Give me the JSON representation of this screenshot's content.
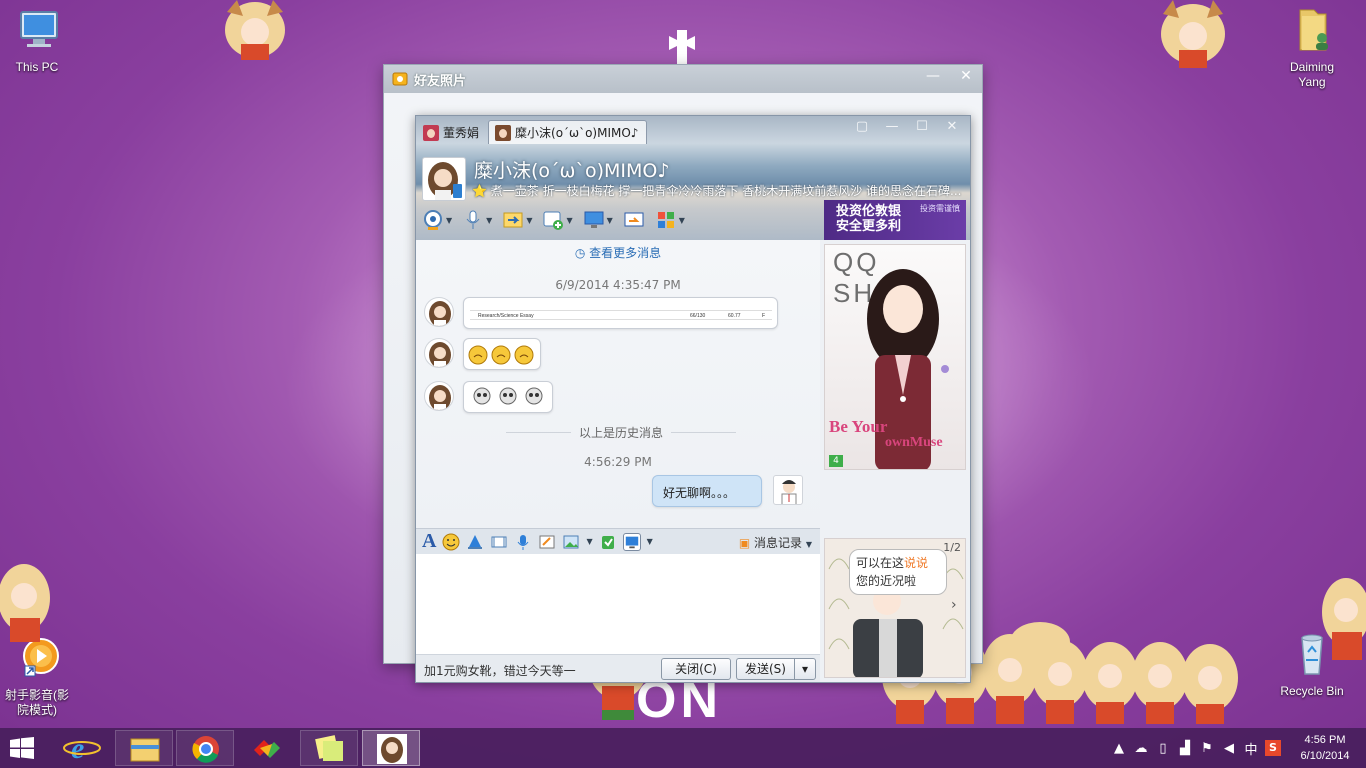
{
  "desktop": {
    "icons": {
      "this_pc": "This PC",
      "user_folder_line1": "Daiming",
      "user_folder_line2": "Yang",
      "player_line1": "射手影音(影",
      "player_line2": "院模式)",
      "recycle_bin": "Recycle Bin"
    },
    "wallpaper_text": "ON"
  },
  "photo_window": {
    "title": "好友照片",
    "minimize": "—",
    "close": "✕"
  },
  "chat_window": {
    "tabs": [
      {
        "label": "董秀娟"
      },
      {
        "label": "糜小沫(o´ω`o)MIMO♪"
      }
    ],
    "controls": {
      "restore": "▢",
      "minimize": "—",
      "maximize": "☐",
      "close": "✕"
    },
    "contact": {
      "name": "糜小沫(o´ω`o)MIMO♪",
      "signature": "⭐ 煮一壶茶 折一枝白梅花 撑一把青伞冷冷雨落下 香桃木开满坟前惹风沙 谁的思念在石碑..."
    },
    "ad_top": {
      "line1": "投资伦敦银",
      "line2": "安全更多利",
      "tag": "投资需谨慎"
    },
    "more_messages": "查看更多消息",
    "messages": {
      "timestamp1": "6/9/2014 4:35:47 PM",
      "attachment": {
        "title": "Research/Science Essay",
        "c1": "66/130",
        "c2": "60.77",
        "c3": "F"
      },
      "history_sep": "以上是历史消息",
      "timestamp2": "4:56:29 PM",
      "mine_text": "好无聊啊。。。"
    },
    "input_toolbar": {
      "history_label": "消息记录"
    },
    "bottom": {
      "promo": "加1元购女靴，错过今天等一",
      "close_button": "关闭(C)",
      "send_button": "发送(S)"
    },
    "show_panel": {
      "title": "QQ SHOW",
      "foot1": "Be Your",
      "foot2": "ownMuse",
      "badge": "4"
    },
    "show_panel2": {
      "pager": "1/2",
      "speech_prefix": "可以在这",
      "speech_highlight": "说说",
      "speech_line2": "您的近况啦"
    }
  },
  "taskbar": {
    "clock_time": "4:56 PM",
    "clock_date": "6/10/2014",
    "ime": "中"
  },
  "colors": {
    "wallpaper": "#8a3f9f",
    "accent_link": "#2a6db5",
    "my_bubble": "#cfe4f7"
  }
}
